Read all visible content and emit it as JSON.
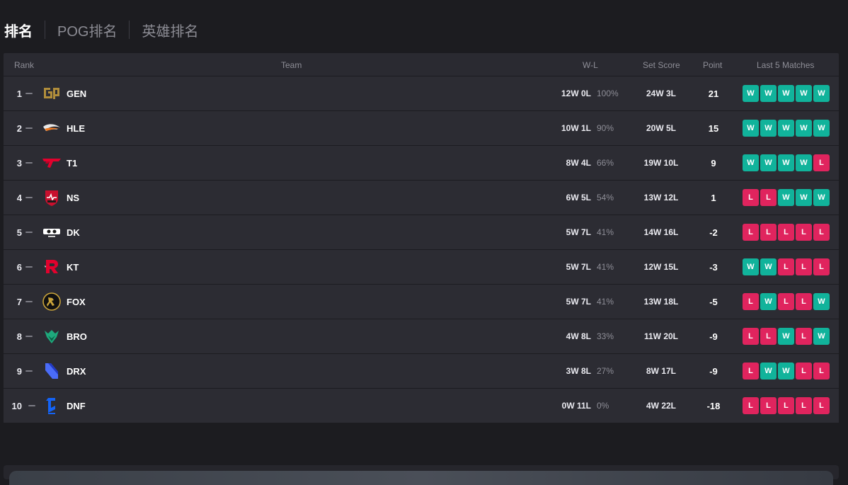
{
  "tabs": [
    {
      "label": "排名",
      "active": true
    },
    {
      "label": "POG排名",
      "active": false
    },
    {
      "label": "英雄排名",
      "active": false
    }
  ],
  "table": {
    "headers": {
      "rank": "Rank",
      "team": "Team",
      "wl": "W-L",
      "set_score": "Set Score",
      "point": "Point",
      "last5": "Last 5 Matches"
    },
    "rows": [
      {
        "rank": "1",
        "team": "GEN",
        "logo": "gen-logo",
        "wl": "12W 0L",
        "pct": "100%",
        "set": "24W 3L",
        "point": "21",
        "last5": [
          "W",
          "W",
          "W",
          "W",
          "W"
        ]
      },
      {
        "rank": "2",
        "team": "HLE",
        "logo": "hle-logo",
        "wl": "10W 1L",
        "pct": "90%",
        "set": "20W 5L",
        "point": "15",
        "last5": [
          "W",
          "W",
          "W",
          "W",
          "W"
        ]
      },
      {
        "rank": "3",
        "team": "T1",
        "logo": "t1-logo",
        "wl": "8W 4L",
        "pct": "66%",
        "set": "19W 10L",
        "point": "9",
        "last5": [
          "W",
          "W",
          "W",
          "W",
          "L"
        ]
      },
      {
        "rank": "4",
        "team": "NS",
        "logo": "ns-logo",
        "wl": "6W 5L",
        "pct": "54%",
        "set": "13W 12L",
        "point": "1",
        "last5": [
          "L",
          "L",
          "W",
          "W",
          "W"
        ]
      },
      {
        "rank": "5",
        "team": "DK",
        "logo": "dk-logo",
        "wl": "5W 7L",
        "pct": "41%",
        "set": "14W 16L",
        "point": "-2",
        "last5": [
          "L",
          "L",
          "L",
          "L",
          "L"
        ]
      },
      {
        "rank": "6",
        "team": "KT",
        "logo": "kt-logo",
        "wl": "5W 7L",
        "pct": "41%",
        "set": "12W 15L",
        "point": "-3",
        "last5": [
          "W",
          "W",
          "L",
          "L",
          "L"
        ]
      },
      {
        "rank": "7",
        "team": "FOX",
        "logo": "fox-logo",
        "wl": "5W 7L",
        "pct": "41%",
        "set": "13W 18L",
        "point": "-5",
        "last5": [
          "L",
          "W",
          "L",
          "L",
          "W"
        ]
      },
      {
        "rank": "8",
        "team": "BRO",
        "logo": "bro-logo",
        "wl": "4W 8L",
        "pct": "33%",
        "set": "11W 20L",
        "point": "-9",
        "last5": [
          "L",
          "L",
          "W",
          "L",
          "W"
        ]
      },
      {
        "rank": "9",
        "team": "DRX",
        "logo": "drx-logo",
        "wl": "3W 8L",
        "pct": "27%",
        "set": "8W 17L",
        "point": "-9",
        "last5": [
          "L",
          "W",
          "W",
          "L",
          "L"
        ]
      },
      {
        "rank": "10",
        "team": "DNF",
        "logo": "dnf-logo",
        "wl": "0W 11L",
        "pct": "0%",
        "set": "4W 22L",
        "point": "-18",
        "last5": [
          "L",
          "L",
          "L",
          "L",
          "L"
        ]
      }
    ]
  },
  "colors": {
    "win": "#11b39b",
    "loss": "#e0245e",
    "background": "#1c1c20",
    "table_bg": "#2c2c33"
  }
}
